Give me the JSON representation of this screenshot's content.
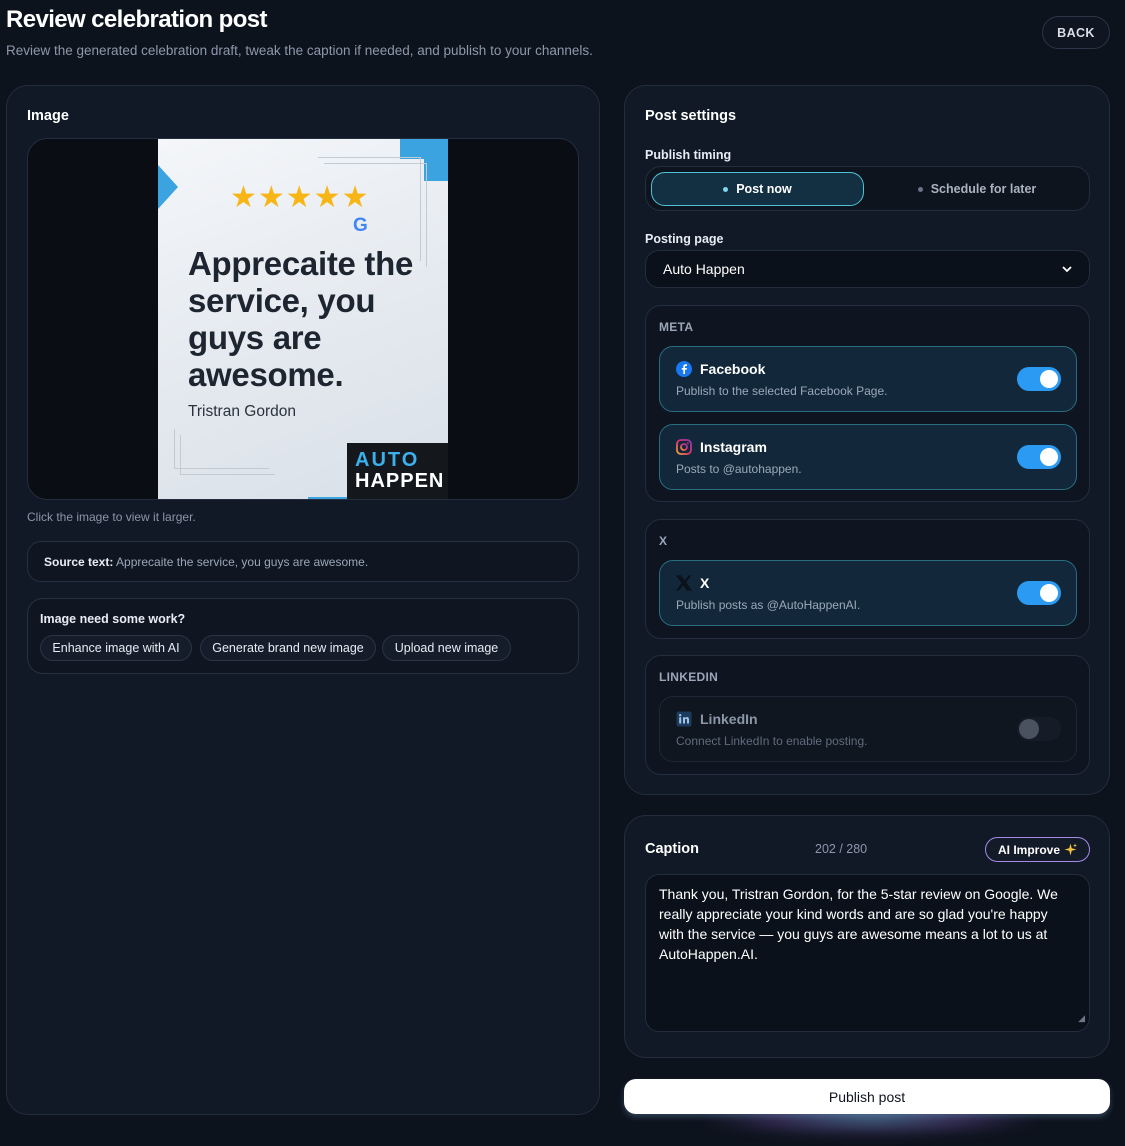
{
  "header": {
    "title": "Review celebration post",
    "subtitle": "Review the generated celebration draft, tweak the caption if needed, and publish to your channels.",
    "back_label": "BACK"
  },
  "image_panel": {
    "title": "Image",
    "poster": {
      "stars": "★★★★★",
      "google_mark": "G",
      "quote": "Apprecaite the service, you guys are awesome.",
      "author": "Tristran Gordon",
      "brand_line1": "AUTO",
      "brand_line2": "HAPPEN"
    },
    "hint": "Click the image to view it larger.",
    "source_label": "Source text:",
    "source_text": "Apprecaite the service, you guys are awesome.",
    "work_title": "Image need some work?",
    "buttons": {
      "enhance": "Enhance image with AI",
      "generate": "Generate brand new image",
      "upload": "Upload new image"
    }
  },
  "settings": {
    "title": "Post settings",
    "timing_label": "Publish timing",
    "timing_options": {
      "now": "Post now",
      "later": "Schedule for later"
    },
    "page_label": "Posting page",
    "page_value": "Auto Happen",
    "groups": {
      "meta": {
        "title": "META",
        "facebook": {
          "name": "Facebook",
          "desc": "Publish to the selected Facebook Page.",
          "enabled": true
        },
        "instagram": {
          "name": "Instagram",
          "desc": "Posts to @autohappen.",
          "enabled": true
        }
      },
      "x": {
        "title": "X",
        "x": {
          "name": "X",
          "desc": "Publish posts as @AutoHappenAI.",
          "enabled": true
        }
      },
      "linkedin": {
        "title": "LINKEDIN",
        "linkedin": {
          "name": "LinkedIn",
          "desc": "Connect LinkedIn to enable posting.",
          "enabled": false
        }
      }
    }
  },
  "caption": {
    "title": "Caption",
    "count": "202 / 280",
    "ai_label": "AI Improve",
    "text": "Thank you, Tristran Gordon, for the 5-star review on Google. We really appreciate your kind words and are so glad you're happy with the service — you guys are awesome means a lot to us at AutoHappen.AI."
  },
  "publish_label": "Publish post",
  "colors": {
    "background": "#0d131d",
    "accent": "#2b9af3",
    "active_border": "#4ec3d6",
    "brand_blue": "#3aa3e0"
  }
}
